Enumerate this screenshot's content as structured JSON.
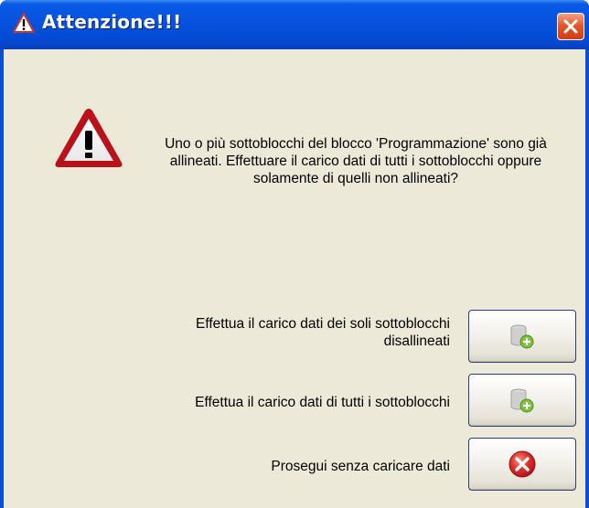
{
  "window": {
    "title": "Attenzione!!!"
  },
  "dialog": {
    "message": "Uno o più sottoblocchi del blocco 'Programmazione' sono già allineati. Effettuare il carico dati di tutti i sottoblocchi oppure solamente di quelli non allineati?",
    "options": [
      {
        "label_line1": "Effettua il carico dati dei soli sottoblocchi",
        "label_line2": "disallineati",
        "icon": "database-load-icon"
      },
      {
        "label": "Effettua il carico dati di tutti i sottoblocchi",
        "icon": "database-load-icon"
      },
      {
        "label": "Prosegui senza caricare dati",
        "icon": "cancel-red-x-icon"
      }
    ]
  },
  "colors": {
    "titlebar": "#0552df",
    "client_bg": "#ece9d8",
    "close_button": "#e4562e",
    "cancel_icon": "#d62a2a",
    "db_plus": "#7cc23a"
  }
}
